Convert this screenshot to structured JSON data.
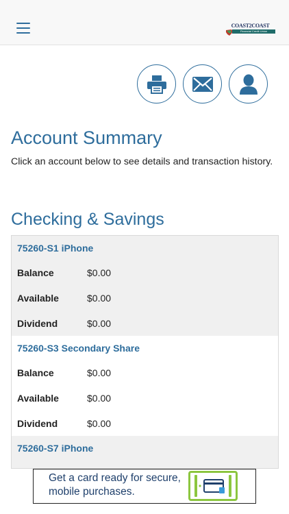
{
  "header": {
    "menu_icon": "hamburger-menu-icon",
    "logo": {
      "title": "COAST2COAST",
      "subtitle": "Financial Credit Union"
    }
  },
  "actions": [
    {
      "name": "print",
      "icon": "printer-icon"
    },
    {
      "name": "message",
      "icon": "envelope-icon"
    },
    {
      "name": "profile",
      "icon": "user-icon"
    }
  ],
  "summary": {
    "title": "Account Summary",
    "subtitle": "Click an account below to see details and transaction history."
  },
  "checking_savings": {
    "title": "Checking & Savings",
    "accounts": [
      {
        "name": "75260-S1 iPhone",
        "rows": [
          {
            "label": "Balance",
            "value": "$0.00"
          },
          {
            "label": "Available",
            "value": "$0.00"
          },
          {
            "label": "Dividend",
            "value": "$0.00"
          }
        ]
      },
      {
        "name": "75260-S3 Secondary Share",
        "rows": [
          {
            "label": "Balance",
            "value": "$0.00"
          },
          {
            "label": "Available",
            "value": "$0.00"
          },
          {
            "label": "Dividend",
            "value": "$0.00"
          }
        ]
      },
      {
        "name": "75260-S7 iPhone",
        "rows": []
      }
    ]
  },
  "ad": {
    "text": "Get a card ready for secure, mobile purchases.",
    "icon": "card-reader-icon"
  },
  "colors": {
    "accent": "#2e6d9c",
    "shaded_row": "#f0f0f0",
    "ad_green": "#8cc63f"
  }
}
